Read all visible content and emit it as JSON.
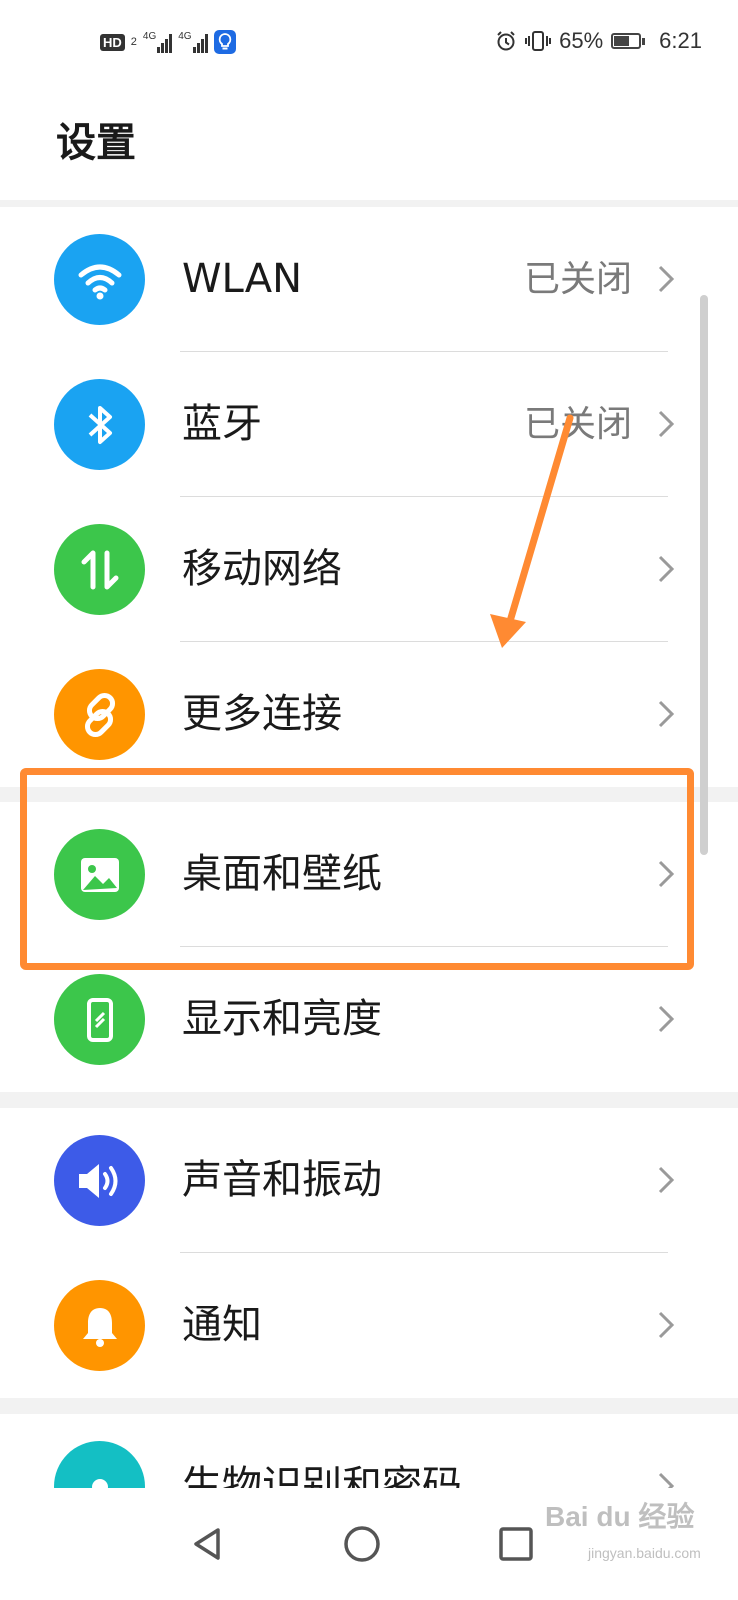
{
  "status_bar": {
    "hd_label": "HD",
    "sim_number": "2",
    "network_1": "4G",
    "network_2": "4G",
    "battery_percent": "65%",
    "battery_level": 0.65,
    "time": "6:21"
  },
  "page": {
    "title": "设置"
  },
  "settings": [
    {
      "label": "WLAN",
      "value": "已关闭",
      "icon": "wifi-icon",
      "color": "#1aa3f2"
    },
    {
      "label": "蓝牙",
      "value": "已关闭",
      "icon": "bluetooth-icon",
      "color": "#1aa3f2"
    },
    {
      "label": "移动网络",
      "value": "",
      "icon": "mobile-data-icon",
      "color": "#3cc64b"
    },
    {
      "label": "更多连接",
      "value": "",
      "icon": "link-icon",
      "color": "#ff9500"
    },
    {
      "label": "桌面和壁纸",
      "value": "",
      "icon": "wallpaper-icon",
      "color": "#3cc64b"
    },
    {
      "label": "显示和亮度",
      "value": "",
      "icon": "display-icon",
      "color": "#3cc64b"
    },
    {
      "label": "声音和振动",
      "value": "",
      "icon": "sound-icon",
      "color": "#3d5be8"
    },
    {
      "label": "通知",
      "value": "",
      "icon": "bell-icon",
      "color": "#ff9500"
    },
    {
      "label": "生物识别和密码",
      "value": "",
      "icon": "fingerprint-icon",
      "color": "#14bfc4"
    }
  ],
  "annotation": {
    "highlight_color": "#ff8a32"
  },
  "nav": {
    "back": "back-icon",
    "home": "home-icon",
    "recents": "recents-icon"
  },
  "watermark": {
    "main": "Bai du 经验",
    "sub": "jingyan.baidu.com"
  }
}
